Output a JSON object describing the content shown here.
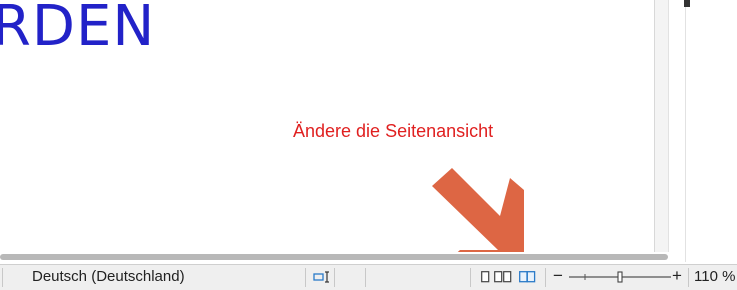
{
  "document": {
    "heading_fragment": "RDEN"
  },
  "annotation": {
    "text": "Ändere die Seitenansicht",
    "color": "#e02020",
    "arrow_color": "#dd6644"
  },
  "statusbar": {
    "language": "Deutsch (Deutschland)",
    "selection_mode_icon": "text-selection-icon",
    "view_layouts": [
      "single-page-view-icon",
      "multi-page-view-icon",
      "book-view-icon"
    ],
    "active_view": "book-view-icon",
    "zoom_out_label": "−",
    "zoom_in_label": "+",
    "zoom_level": "110 %",
    "zoom_fraction": 0.5
  },
  "colors": {
    "heading": "#2222c8",
    "statusbar_bg": "#efefef",
    "active_icon": "#2a7ac8"
  }
}
